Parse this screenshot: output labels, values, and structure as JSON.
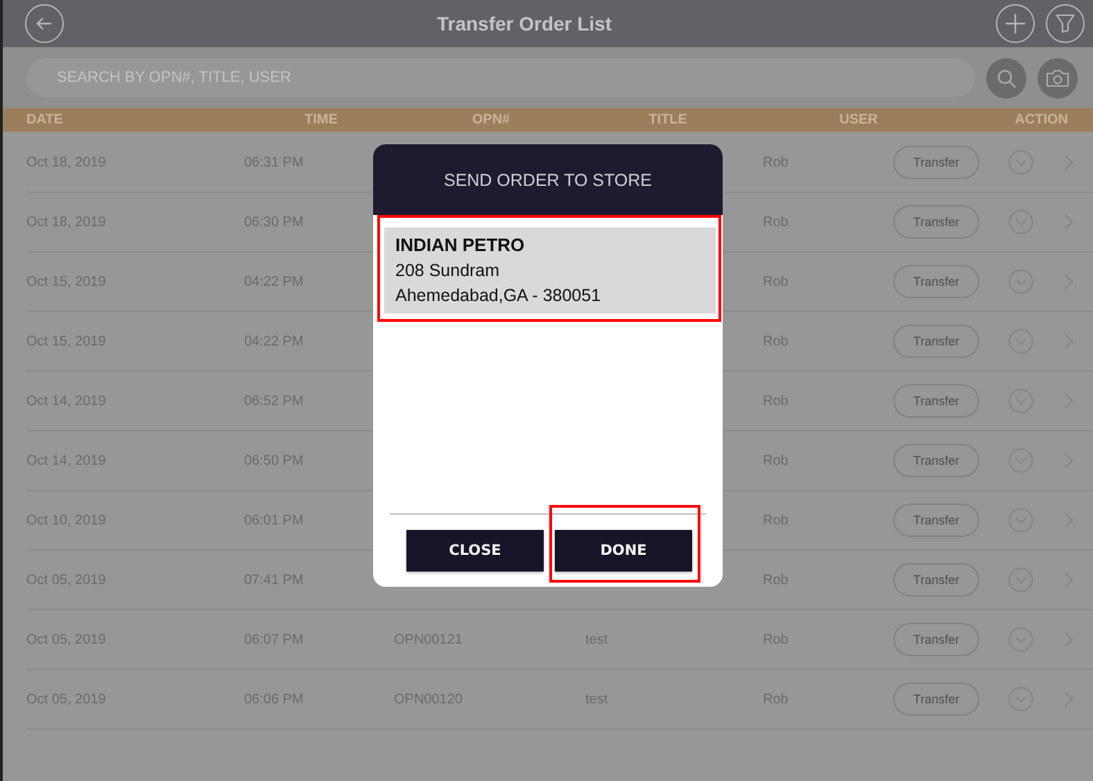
{
  "header": {
    "title": "Transfer Order List"
  },
  "search": {
    "placeholder": "SEARCH BY OPN#, TITLE, USER"
  },
  "table": {
    "columns": [
      "DATE",
      "TIME",
      "OPN#",
      "TITLE",
      "USER",
      "ACTION"
    ],
    "rows": [
      {
        "date": "Oct 18, 2019",
        "time": "06:31 PM",
        "user": "Rob",
        "action": "Transfer"
      },
      {
        "date": "Oct 18, 2019",
        "time": "06:30 PM",
        "user": "Rob",
        "action": "Transfer"
      },
      {
        "date": "Oct 15, 2019",
        "time": "04:22 PM",
        "user": "Rob",
        "action": "Transfer"
      },
      {
        "date": "Oct 15, 2019",
        "time": "04:22 PM",
        "user": "Rob",
        "action": "Transfer"
      },
      {
        "date": "Oct 14, 2019",
        "time": "06:52 PM",
        "user": "Rob",
        "action": "Transfer"
      },
      {
        "date": "Oct 14, 2019",
        "time": "06:50 PM",
        "user": "Rob",
        "action": "Transfer"
      },
      {
        "date": "Oct 10, 2019",
        "time": "06:01 PM",
        "user": "Rob",
        "action": "Transfer"
      },
      {
        "date": "Oct 05, 2019",
        "time": "07:41 PM",
        "user": "Rob",
        "action": "Transfer"
      },
      {
        "date": "Oct 05, 2019",
        "time": "06:07 PM",
        "opn": "OPN00121",
        "title": "test",
        "user": "Rob",
        "action": "Transfer"
      },
      {
        "date": "Oct 05, 2019",
        "time": "06:06 PM",
        "opn": "OPN00120",
        "title": "test",
        "user": "Rob",
        "action": "Transfer"
      }
    ]
  },
  "dialog": {
    "title": "SEND ORDER TO STORE",
    "stores": [
      {
        "name": "INDIAN PETRO",
        "lines": [
          "208 Sundram",
          "Ahemedabad,GA - 380051"
        ],
        "selected": true,
        "highlighted": true
      }
    ],
    "buttons": [
      {
        "label": "CLOSE",
        "highlighted": false
      },
      {
        "label": "DONE",
        "highlighted": true
      }
    ]
  }
}
